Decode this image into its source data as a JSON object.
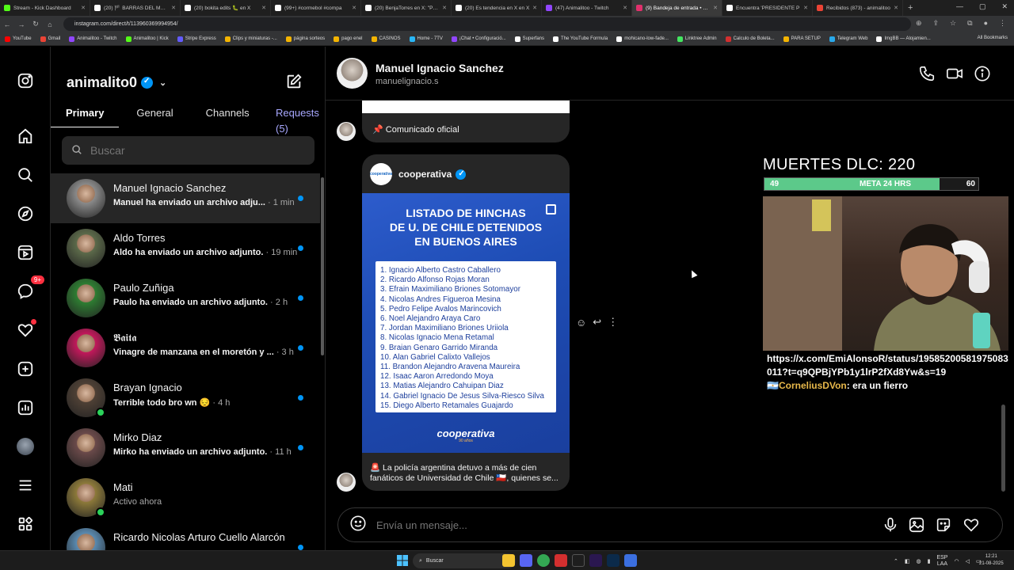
{
  "browser": {
    "tabs": [
      {
        "title": "Stream - Kick Dashboard",
        "color": "#53fc18"
      },
      {
        "title": "(20) 🏴 BARRAS DEL MUNDO",
        "color": "#ffffff"
      },
      {
        "title": "(20) bokita edits 🐛 en X",
        "color": "#ffffff"
      },
      {
        "title": "(99+) #cormebol #compa",
        "color": "#ffffff"
      },
      {
        "title": "(20) BenjaTorres en X: \"Poder",
        "color": "#ffffff"
      },
      {
        "title": "(20) Es tendencia en X en X",
        "color": "#ffffff"
      },
      {
        "title": "(47) Animalitoo - Twitch",
        "color": "#9146ff"
      },
      {
        "title": "(9) Bandeja de entrada • Chat",
        "color": "#e1306c"
      },
      {
        "title": "Encuentra 'PRESIDENTE P",
        "color": "#ffffff"
      },
      {
        "title": "Recibidos (873) - animalitoo",
        "color": "#ea4335"
      }
    ],
    "url": "instagram.com/direct/t/113960369994954/",
    "bookmarks": [
      {
        "label": "YouTube",
        "color": "#ff0000"
      },
      {
        "label": "Gmail",
        "color": "#ea4335"
      },
      {
        "label": "Animalitoo - Twitch",
        "color": "#9146ff"
      },
      {
        "label": "Animalitoo | Kick",
        "color": "#53fc18"
      },
      {
        "label": "Stripe Express",
        "color": "#635bff"
      },
      {
        "label": "Clips y miniaturas -...",
        "color": "#f4b400"
      },
      {
        "label": "página sorteos",
        "color": "#f4b400"
      },
      {
        "label": "pago enel",
        "color": "#f4b400"
      },
      {
        "label": "CASINOS",
        "color": "#f4b400"
      },
      {
        "label": "Home - 7TV",
        "color": "#29b6f6"
      },
      {
        "label": "¡Chat • Configuració...",
        "color": "#9146ff"
      },
      {
        "label": "Superfans",
        "color": "#ffffff"
      },
      {
        "label": "The YouTube Formula",
        "color": "#ffffff"
      },
      {
        "label": "mohicano-low-fade...",
        "color": "#ffffff"
      },
      {
        "label": "Linktree Admin",
        "color": "#43e660"
      },
      {
        "label": "Calculo de Boleta...",
        "color": "#d32f2f"
      },
      {
        "label": "PARA SETUP",
        "color": "#f4b400"
      },
      {
        "label": "Telegram Web",
        "color": "#29a9eb"
      },
      {
        "label": "ImgBB — Alojamien...",
        "color": "#ffffff"
      }
    ],
    "all_bookmarks": "All Bookmarks"
  },
  "sidebar": {
    "messages_badge": "9+"
  },
  "inbox": {
    "account": "animalito0",
    "tabs": {
      "primary": "Primary",
      "general": "General",
      "channels": "Channels",
      "requests": "Requests (5)"
    },
    "search_placeholder": "Buscar",
    "conversations": [
      {
        "name": "Manuel Ignacio Sanchez",
        "preview": "Manuel ha enviado un archivo adju...",
        "time": "· 1 min",
        "unread": true,
        "avatar": "#8a8a8a"
      },
      {
        "name": "Aldo Torres",
        "preview": "Aldo ha enviado un archivo adjunto.",
        "time": "· 19 min",
        "unread": true,
        "avatar": "#5c6a4a"
      },
      {
        "name": "Paulo Zuñiga",
        "preview": "Paulo ha enviado un archivo adjunto.",
        "time": "· 2 h",
        "unread": true,
        "avatar": "#2e7d32"
      },
      {
        "name": "𝕭𝖆𝖎𝖙𝖆",
        "preview": "Vinagre de manzana en el moretón y ...",
        "time": "· 3 h",
        "unread": true,
        "avatar": "#c2185b"
      },
      {
        "name": "Brayan Ignacio",
        "preview": "Terrible todo bro wn 😔",
        "time": "· 4 h",
        "unread": true,
        "avatar": "#4e4035"
      },
      {
        "name": "Mirko Diaz",
        "preview": "Mirko ha enviado un archivo adjunto.",
        "time": "· 11 h",
        "unread": true,
        "avatar": "#6b4a4a"
      },
      {
        "name": "Mati",
        "preview": "Activo ahora",
        "time": "",
        "unread": false,
        "avatar": "#8d7a3a"
      },
      {
        "name": "Ricardo Nicolas Arturo Cuello Alarcón",
        "preview": "",
        "time": "",
        "unread": true,
        "avatar": "#5a8ab0"
      }
    ]
  },
  "chat": {
    "name": "Manuel Ignacio Sanchez",
    "username": "manuelignacio.s",
    "shared1_caption": "📌 Comunicado oficial",
    "shared2": {
      "account": "cooperativa",
      "logo_text": "cooperativa",
      "poster_title_1": "LISTADO DE HINCHAS",
      "poster_title_2": "DE U. DE CHILE DETENIDOS",
      "poster_title_3": "EN BUENOS AIRES",
      "list": [
        "1. Ignacio Alberto Castro Caballero",
        "2. Ricardo Alfonso Rojas Moran",
        "3. Efrain Maximiliano Briones Sotomayor",
        "4. Nicolas Andres Figueroa Mesina",
        "5. Pedro Felipe Avalos Marincovich",
        "6. Noel Alejandro Araya Caro",
        "7. Jordan Maximiliano Briones Uriiola",
        "8. Nicolas Ignacio Mena Retamal",
        "9. Braian Genaro Garrido Miranda",
        "10. Alan Gabriel Calixto Vallejos",
        "11. Brandon Alejandro Aravena Maureira",
        "12. Isaac Aaron Arredondo Moya",
        "13. Matias Alejandro Cahuipan Diaz",
        "14. Gabriel Ignacio De Jesus Silva-Riesco Silva",
        "15. Diego Alberto Retamales Guajardo"
      ],
      "brand": "cooperativa",
      "brand_sub": "90 años",
      "caption": "🚨 La policía argentina detuvo a más de cien fanáticos de Universidad de Chile 🇨🇱, quienes se..."
    },
    "composer_placeholder": "Envía un mensaje..."
  },
  "overlay": {
    "deaths": "MUERTES DLC: 220",
    "progress_current": "49",
    "progress_label": "META 24 HRS",
    "progress_goal": "60",
    "progress_fraction": 0.8167,
    "chat_link": "https://x.com/EmiAlonsoR/status/19585200581975083011?t=q9QPBjYPb1y1lrP2fXd8Yw&s=19",
    "chat_user": "🇦🇷CorneliusDVon",
    "chat_msg": ": era un fierro"
  },
  "taskbar": {
    "search": "Buscar",
    "lang": "ESP",
    "lang2": "LAA",
    "time": "12:21",
    "date": "21-08-2025"
  }
}
